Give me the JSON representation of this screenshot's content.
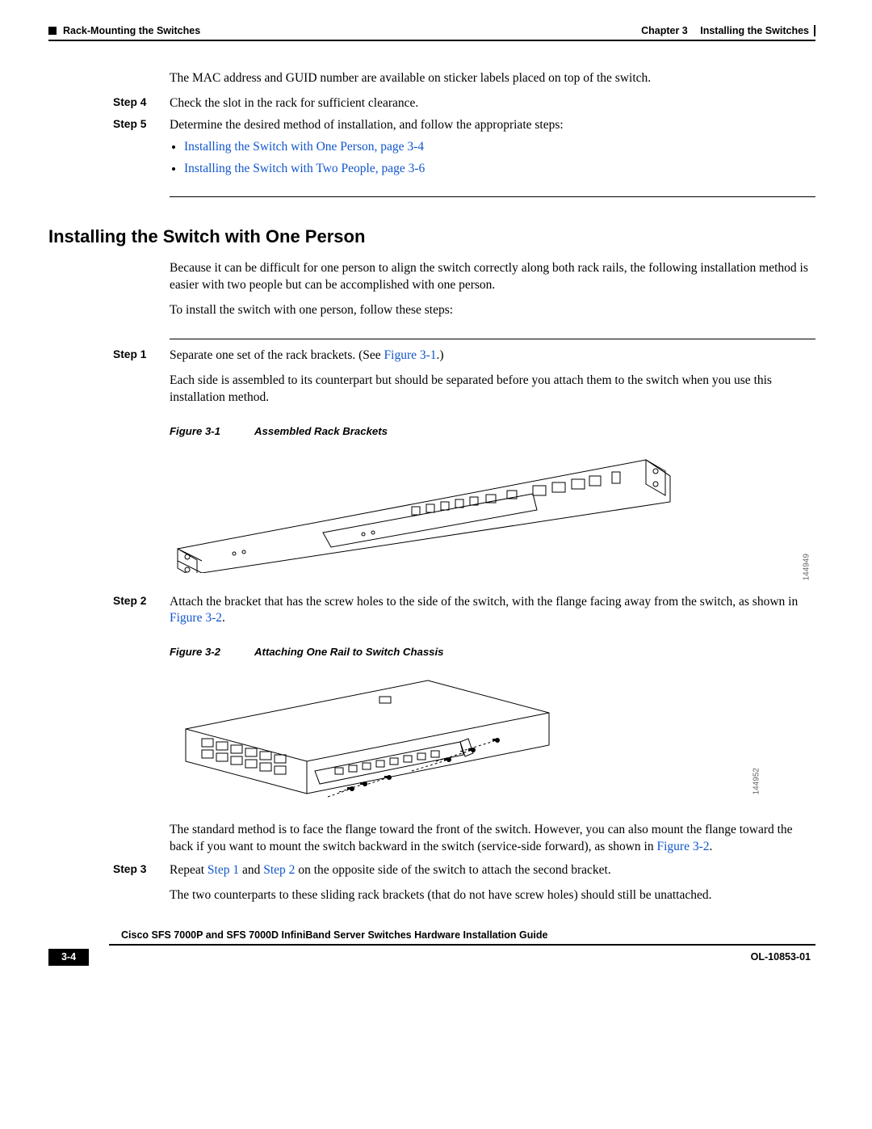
{
  "header": {
    "chapter_label": "Chapter 3",
    "chapter_title": "Installing the Switches",
    "section": "Rack-Mounting the Switches"
  },
  "intro_line": "The MAC address and GUID number are available on sticker labels placed on top of the switch.",
  "step4": {
    "label": "Step 4",
    "text": "Check the slot in the rack for sufficient clearance."
  },
  "step5": {
    "label": "Step 5",
    "text": "Determine the desired method of installation, and follow the appropriate steps:",
    "bullets": [
      "Installing the Switch with One Person, page 3-4",
      "Installing the Switch with Two People, page 3-6"
    ]
  },
  "h2": "Installing the Switch with One Person",
  "para_intro1": "Because it can be difficult for one person to align the switch correctly along both rack rails, the following installation method is easier with two people but can be accomplished with one person.",
  "para_intro2": "To install the switch with one person, follow these steps:",
  "p_step1": {
    "label": "Step 1",
    "t1a": "Separate one set of the rack brackets. (See ",
    "t1_link": "Figure 3-1",
    "t1b": ".)",
    "t2": "Each side is assembled to its counterpart but should be separated before you attach them to the switch when you use this installation method."
  },
  "fig1": {
    "num": "Figure 3-1",
    "title": "Assembled Rack Brackets",
    "id": "144949"
  },
  "p_step2": {
    "label": "Step 2",
    "t1a": "Attach the bracket that has the screw holes to the side of the switch, with the flange facing away from the switch, as shown in ",
    "t1_link": "Figure 3-2",
    "t1b": "."
  },
  "fig2": {
    "num": "Figure 3-2",
    "title": "Attaching One Rail to Switch Chassis",
    "id": "144952"
  },
  "para_post_fig2_a": "The standard method is to face the flange toward the front of the switch. However, you can also mount the flange toward the back if you want to mount the switch backward in the switch (service-side forward), as shown in ",
  "para_post_fig2_link": "Figure 3-2",
  "para_post_fig2_b": ".",
  "p_step3": {
    "label": "Step 3",
    "t1a": "Repeat ",
    "link1": "Step 1",
    "mid": " and ",
    "link2": "Step 2",
    "t1b": " on the opposite side of the switch to attach the second bracket.",
    "t2": "The two counterparts to these sliding rack brackets (that do not have screw holes) should still be unattached."
  },
  "footer": {
    "guide": "Cisco SFS 7000P and SFS 7000D InfiniBand Server Switches Hardware Installation Guide",
    "page": "3-4",
    "docnum": "OL-10853-01"
  }
}
